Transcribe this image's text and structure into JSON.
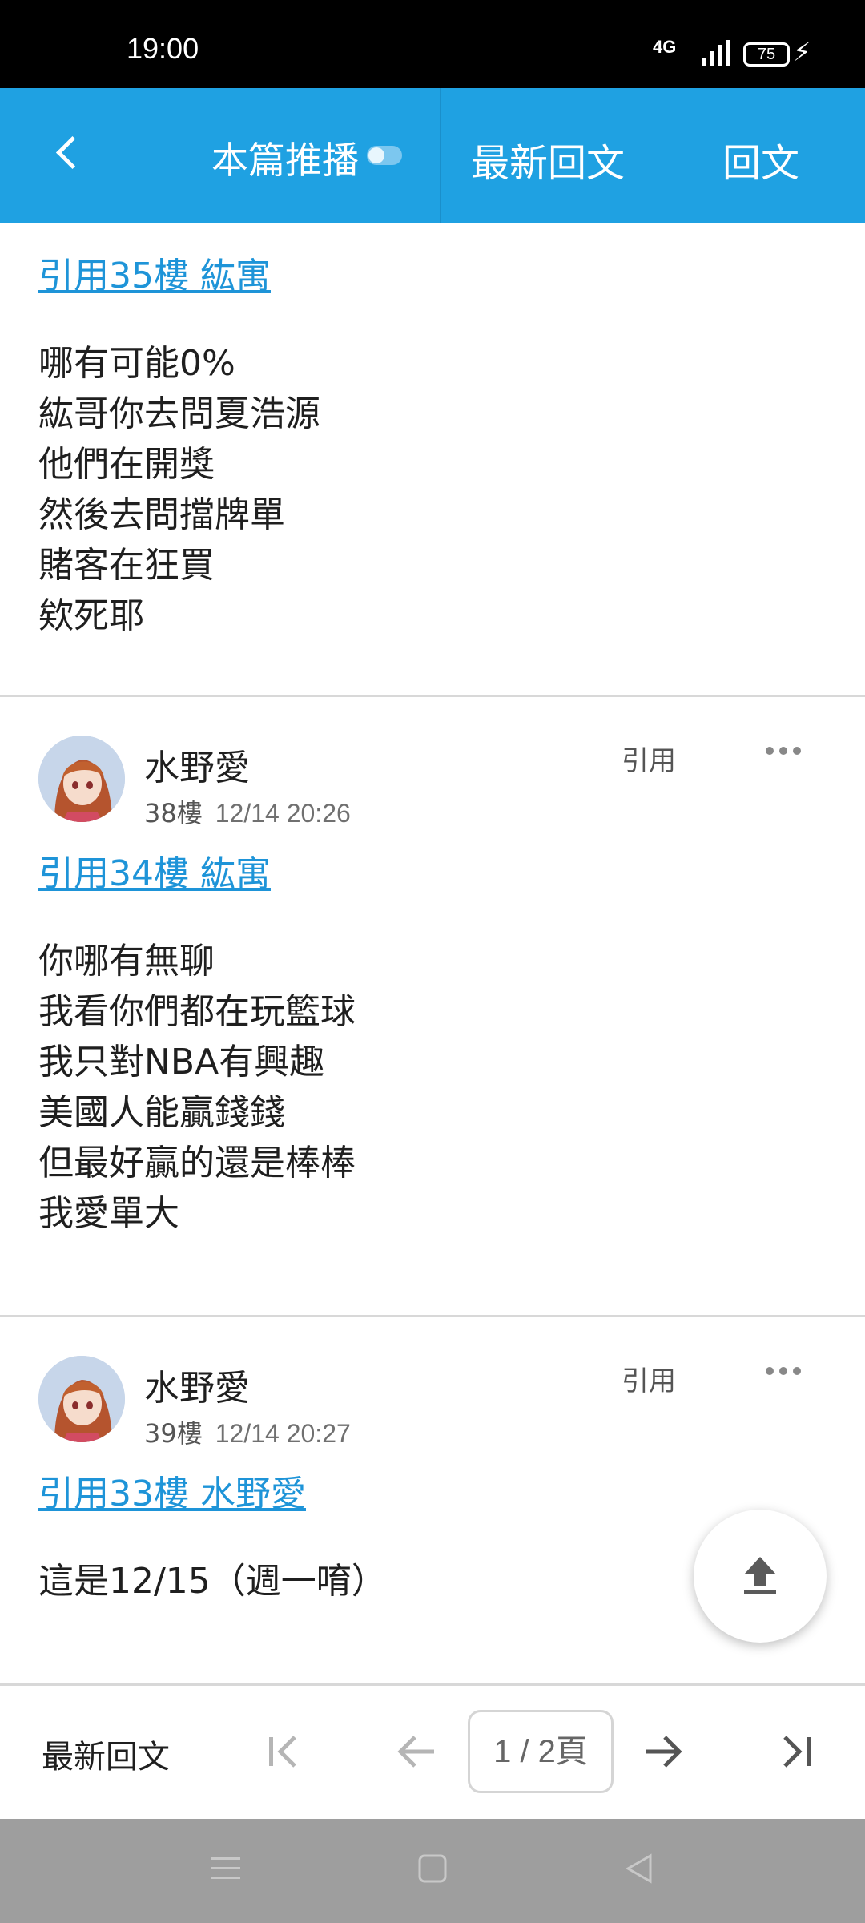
{
  "status_bar": {
    "time": "19:00",
    "network": "4G",
    "battery": "75"
  },
  "app_bar": {
    "push_label": "本篇推播",
    "latest_label": "最新回文",
    "reply_label": "回文"
  },
  "posts": [
    {
      "quote": "引用35樓 紘寓",
      "body": "哪有可能0%\n紘哥你去問夏浩源\n他們在開獎\n然後去問擋牌單\n賭客在狂買\n欸死耶"
    },
    {
      "author": "水野愛",
      "floor": "38樓",
      "date": "12/14 20:26",
      "quote_label": "引用",
      "quote": "引用34樓 紘寓",
      "body": "你哪有無聊\n我看你們都在玩籃球\n我只對NBA有興趣\n美國人能贏錢錢\n但最好贏的還是棒棒\n我愛單大"
    },
    {
      "author": "水野愛",
      "floor": "39樓",
      "date": "12/14 20:27",
      "quote_label": "引用",
      "quote": "引用33樓 水野愛",
      "body": "這是12/15（週一唷）"
    }
  ],
  "bottom_bar": {
    "label": "最新回文",
    "page": "1 / 2頁"
  },
  "colors": {
    "accent": "#1fa1e2",
    "link": "#1e94d8"
  }
}
